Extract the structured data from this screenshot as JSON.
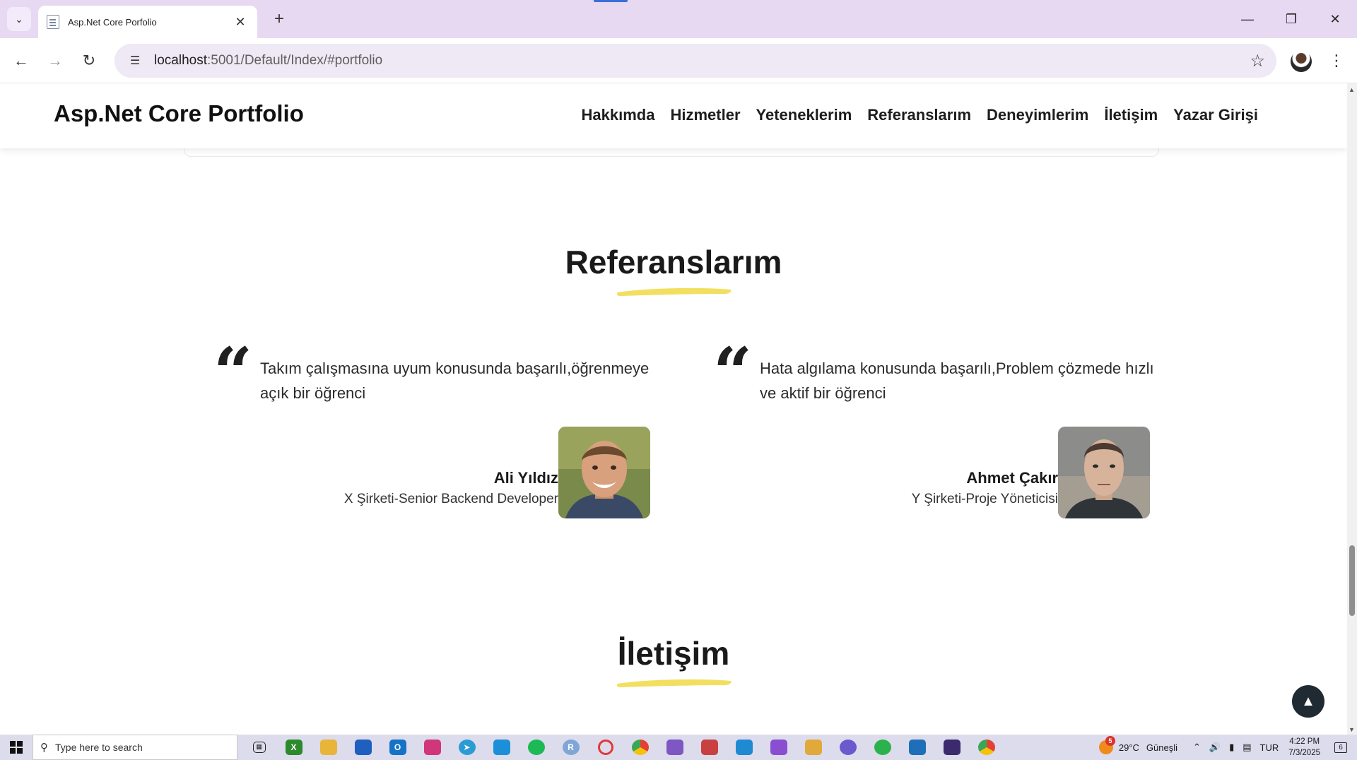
{
  "browser": {
    "tab_title": "Asp.Net Core Porfolio",
    "new_tab": "+",
    "url_host": "localhost",
    "url_path": ":5001/Default/Index/#portfolio"
  },
  "site": {
    "brand": "Asp.Net Core Portfolio",
    "nav": [
      "Hakkımda",
      "Hizmetler",
      "Yeteneklerim",
      "Referanslarım",
      "Deneyimlerim",
      "İletişim",
      "Yazar Girişi"
    ],
    "section_referanslar": "Referanslarım",
    "section_iletisim": "İletişim",
    "accent_color": "#f3df5f",
    "testimonials": [
      {
        "quote": "Takım çalışmasına uyum konusunda başarılı,öğrenmeye açık bir öğrenci",
        "name": "Ali Yıldız",
        "role": "X Şirketi-Senior Backend Developer"
      },
      {
        "quote": "Hata algılama konusunda başarılı,Problem çözmede hızlı ve aktif bir öğrenci",
        "name": "Ahmet Çakır",
        "role": "Y Şirketi-Proje Yöneticisi"
      }
    ]
  },
  "taskbar": {
    "search_placeholder": "Type here to search",
    "weather_temp": "29°C",
    "weather_desc": "Güneşli",
    "weather_badge": "5",
    "language": "TUR",
    "time": "4:22 PM",
    "date": "7/3/2025",
    "notification_count": "6",
    "apps": [
      "xbox-icon",
      "file-explorer-icon",
      "microsoft-store-icon",
      "outlook-icon",
      "instagram-icon",
      "telegram-icon",
      "twitter-icon",
      "spotify-icon",
      "r-app-icon",
      "opera-icon",
      "chrome-icon",
      "visual-studio-icon",
      "app-icon",
      "vscode-icon",
      "visual-studio-2-icon",
      "tools-icon",
      "podcast-icon",
      "whatsapp-icon",
      "prime-video-icon",
      "terminal-icon",
      "chrome-profile-icon"
    ]
  }
}
